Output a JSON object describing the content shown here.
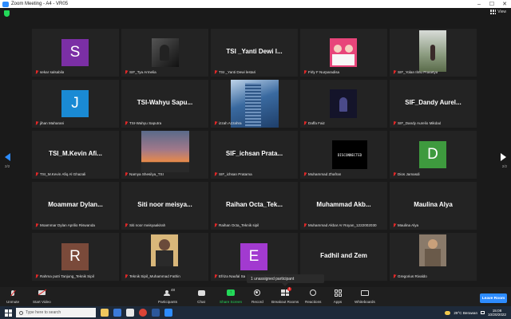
{
  "window": {
    "title": "Zoom Meeting - A4 - VR05",
    "controls": [
      "–",
      "☐",
      "✕"
    ]
  },
  "top": {
    "view_label": "View"
  },
  "paging": {
    "left": "2/2",
    "right": "2/2"
  },
  "tiles": [
    {
      "kind": "avatar",
      "letter": "S",
      "color": "#7b2fa5",
      "name": "sekar salsabila"
    },
    {
      "kind": "photo",
      "photo": "dark-figure",
      "name": "SIF_Tya Armelia"
    },
    {
      "kind": "name",
      "big": "TSI _Yanti Dewi l...",
      "name": "TSI _Yanti Dewi lestari"
    },
    {
      "kind": "photo",
      "photo": "pink-pair",
      "name": "Firly F Nurparadisa"
    },
    {
      "kind": "photo",
      "photo": "outdoor",
      "name": "SIF_Yolan Ilmu Prasetya"
    },
    {
      "kind": "avatar",
      "letter": "J",
      "color": "#1a8ad4",
      "name": "jihan Maharani"
    },
    {
      "kind": "name",
      "big": "TSI-Wahyu Sapu...",
      "name": "TSI-Wahyu Saputra"
    },
    {
      "kind": "photo",
      "photo": "building",
      "name": "izzah Azzahra"
    },
    {
      "kind": "photo",
      "photo": "night-figure",
      "name": "Daffa Faiz"
    },
    {
      "kind": "name",
      "big": "SIF_Dandy Aurel...",
      "name": "SIF_Dandy Aurelio Mikdad"
    },
    {
      "kind": "name",
      "big": "TSI_M.Kevin Afi...",
      "name": "TSI_M.Kevin Afiq Al Ghazali"
    },
    {
      "kind": "photo",
      "photo": "sunset",
      "name": "Namya Shesilya_TSI"
    },
    {
      "kind": "name",
      "big": "SIF_ichsan Prata...",
      "name": "SIF_ichsan Pratama"
    },
    {
      "kind": "disconnected",
      "big": "DISCONNECTED",
      "name": "Muhammad Zhafran"
    },
    {
      "kind": "avatar",
      "letter": "D",
      "color": "#3e9a3e",
      "name": "Dios Jamasdi"
    },
    {
      "kind": "name",
      "big": "Moammar Dylan...",
      "name": "Moammar Dylan Aprilio Riswanda"
    },
    {
      "kind": "name",
      "big": "Siti noor meisya...",
      "name": "Siti noor meisyaakirah"
    },
    {
      "kind": "name",
      "big": "Raihan Octa_Tek...",
      "name": "Raihan Octa_Teknik sipil"
    },
    {
      "kind": "name",
      "big": "Muhammad Akb...",
      "name": "Muhammad Akbar Ar Royan_1222002030"
    },
    {
      "kind": "name",
      "big": "Maulina Alya",
      "name": "Maulina Alya"
    },
    {
      "kind": "avatar",
      "letter": "R",
      "color": "#7a4a3a",
      "name": "Rahma putri Tanjung_Teknik Sipil"
    },
    {
      "kind": "photo",
      "photo": "portrait",
      "name": "Teknik Sipil_Muhammad Fathin"
    },
    {
      "kind": "avatar",
      "letter": "E",
      "color": "#a23ad0",
      "name": "Efriza Naufal Sa"
    },
    {
      "kind": "name",
      "big": "Fadhil and Zem",
      "name": "d Zem"
    },
    {
      "kind": "photo",
      "photo": "portrait2",
      "name": "Gregorius Rivaldo"
    }
  ],
  "tooltip": {
    "text": "1 unassigned participant"
  },
  "toolbar": {
    "unmute": "Unmute",
    "start_video": "Start Video",
    "participants": "Participants",
    "participants_count": "48",
    "chat": "Chat",
    "share": "Share Screen",
    "record": "Record",
    "rooms": "Breakout Rooms",
    "rooms_badge": "1",
    "reactions": "Reactions",
    "apps": "Apps",
    "whiteboards": "Whiteboards",
    "leave": "Leave Room"
  },
  "taskbar": {
    "search_placeholder": "Type here to search",
    "weather": "29°C  Berawan",
    "time": "15:08",
    "date": "10/20/2022"
  }
}
